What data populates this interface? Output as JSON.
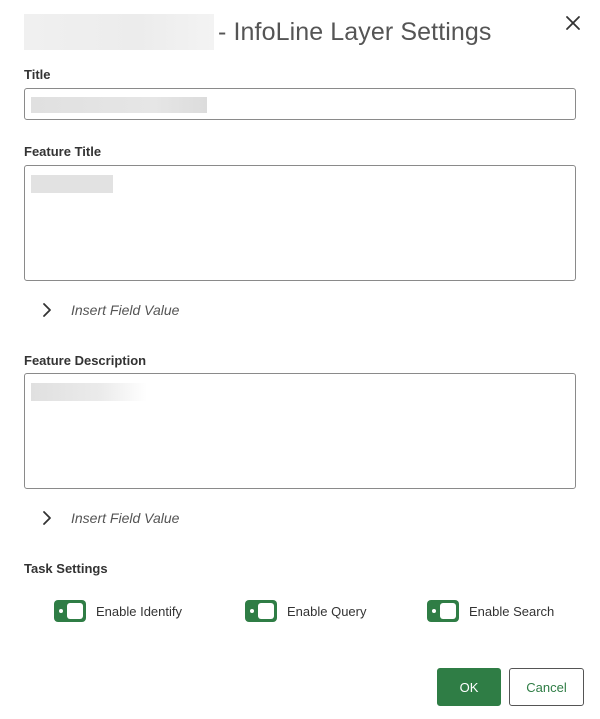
{
  "dialog": {
    "title_suffix": "- InfoLine Layer Settings",
    "close_icon": "close-icon"
  },
  "fields": {
    "title_label": "Title",
    "feature_title_label": "Feature Title",
    "feature_description_label": "Feature Description"
  },
  "insert_field": {
    "label": "Insert Field Value",
    "icon": "chevron-right-icon"
  },
  "task_settings": {
    "label": "Task Settings",
    "toggles": [
      {
        "label": "Enable Identify",
        "enabled": true
      },
      {
        "label": "Enable Query",
        "enabled": true
      },
      {
        "label": "Enable Search",
        "enabled": true
      }
    ]
  },
  "buttons": {
    "ok": "OK",
    "cancel": "Cancel"
  },
  "colors": {
    "accent": "#2f7d45",
    "border": "#8a8a8a"
  }
}
